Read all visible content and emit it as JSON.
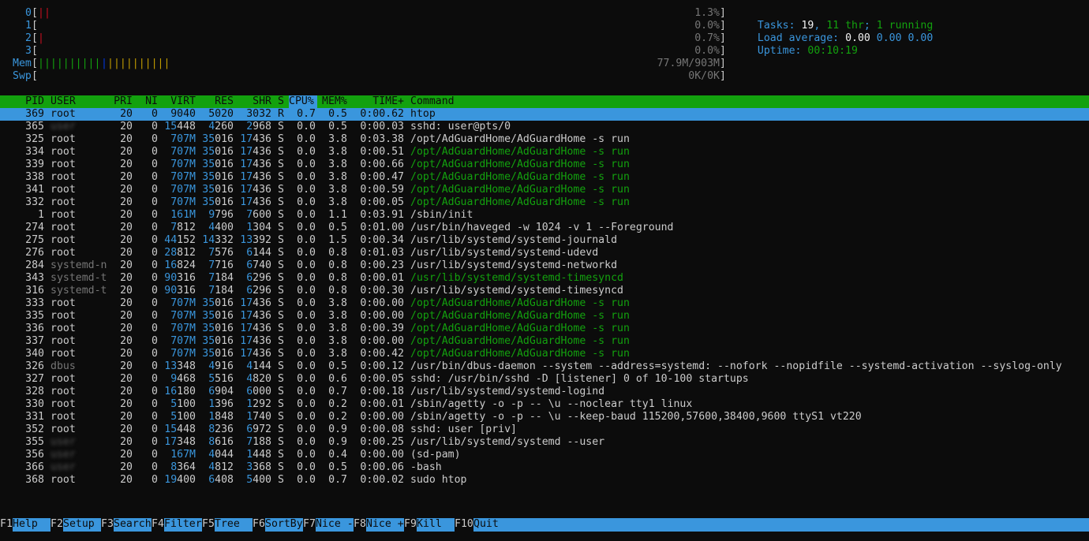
{
  "meters": {
    "cpu": [
      {
        "id": "0",
        "bar": "||",
        "pct": "1.3%"
      },
      {
        "id": "1",
        "bar": "",
        "pct": "0.0%"
      },
      {
        "id": "2",
        "bar": "|",
        "pct": "0.7%"
      },
      {
        "id": "3",
        "bar": "",
        "pct": "0.0%"
      }
    ],
    "mem": {
      "label": "Mem",
      "bar_green": "||||||||||",
      "bar_blue": "|",
      "bar_yellow": "||||||||||",
      "value": "77.9M/903M"
    },
    "swp": {
      "label": "Swp",
      "value": "0K/0K"
    }
  },
  "summary": {
    "tasks_label": "Tasks:",
    "tasks": "19",
    "thr": "11 thr",
    "running": "1 running",
    "load_label": "Load average:",
    "load1": "0.00",
    "load5": "0.00",
    "load15": "0.00",
    "uptime_label": "Uptime:",
    "uptime": "00:10:19"
  },
  "columns": {
    "pid": "PID",
    "user": "USER",
    "pri": "PRI",
    "ni": "NI",
    "virt": "VIRT",
    "res": "RES",
    "shr": "SHR",
    "s": "S",
    "cpu": "CPU%",
    "mem": "MEM%",
    "time": "TIME+",
    "cmd": "Command"
  },
  "processes": [
    {
      "pid": "369",
      "user": "root",
      "pri": "20",
      "ni": "0",
      "virt": "9040",
      "res": "5020",
      "shr": "3032",
      "s": "R",
      "cpu": "0.7",
      "mem": "0.5",
      "time": "0:00.62",
      "cmd": "htop",
      "selected": true
    },
    {
      "pid": "365",
      "user": "user",
      "pri": "20",
      "ni": "0",
      "virt": "15448",
      "res": "4260",
      "shr": "2968",
      "s": "S",
      "cpu": "0.0",
      "mem": "0.5",
      "time": "0:00.03",
      "cmd": "sshd: user@pts/0",
      "blur_user": true
    },
    {
      "pid": "325",
      "user": "root",
      "pri": "20",
      "ni": "0",
      "virt": "707M",
      "res": "35016",
      "shr": "17436",
      "s": "S",
      "cpu": "0.0",
      "mem": "3.8",
      "time": "0:03.38",
      "cmd": "/opt/AdGuardHome/AdGuardHome -s run"
    },
    {
      "pid": "334",
      "user": "root",
      "pri": "20",
      "ni": "0",
      "virt": "707M",
      "res": "35016",
      "shr": "17436",
      "s": "S",
      "cpu": "0.0",
      "mem": "3.8",
      "time": "0:00.51",
      "cmd": "/opt/AdGuardHome/AdGuardHome -s run",
      "thread": true
    },
    {
      "pid": "339",
      "user": "root",
      "pri": "20",
      "ni": "0",
      "virt": "707M",
      "res": "35016",
      "shr": "17436",
      "s": "S",
      "cpu": "0.0",
      "mem": "3.8",
      "time": "0:00.66",
      "cmd": "/opt/AdGuardHome/AdGuardHome -s run",
      "thread": true
    },
    {
      "pid": "338",
      "user": "root",
      "pri": "20",
      "ni": "0",
      "virt": "707M",
      "res": "35016",
      "shr": "17436",
      "s": "S",
      "cpu": "0.0",
      "mem": "3.8",
      "time": "0:00.47",
      "cmd": "/opt/AdGuardHome/AdGuardHome -s run",
      "thread": true
    },
    {
      "pid": "341",
      "user": "root",
      "pri": "20",
      "ni": "0",
      "virt": "707M",
      "res": "35016",
      "shr": "17436",
      "s": "S",
      "cpu": "0.0",
      "mem": "3.8",
      "time": "0:00.59",
      "cmd": "/opt/AdGuardHome/AdGuardHome -s run",
      "thread": true
    },
    {
      "pid": "332",
      "user": "root",
      "pri": "20",
      "ni": "0",
      "virt": "707M",
      "res": "35016",
      "shr": "17436",
      "s": "S",
      "cpu": "0.0",
      "mem": "3.8",
      "time": "0:00.05",
      "cmd": "/opt/AdGuardHome/AdGuardHome -s run",
      "thread": true
    },
    {
      "pid": "1",
      "user": "root",
      "pri": "20",
      "ni": "0",
      "virt": "161M",
      "res": "9796",
      "shr": "7600",
      "s": "S",
      "cpu": "0.0",
      "mem": "1.1",
      "time": "0:03.91",
      "cmd": "/sbin/init"
    },
    {
      "pid": "274",
      "user": "root",
      "pri": "20",
      "ni": "0",
      "virt": "7812",
      "res": "4400",
      "shr": "1304",
      "s": "S",
      "cpu": "0.0",
      "mem": "0.5",
      "time": "0:01.00",
      "cmd": "/usr/bin/haveged -w 1024 -v 1 --Foreground"
    },
    {
      "pid": "275",
      "user": "root",
      "pri": "20",
      "ni": "0",
      "virt": "44152",
      "res": "14332",
      "shr": "13392",
      "s": "S",
      "cpu": "0.0",
      "mem": "1.5",
      "time": "0:00.34",
      "cmd": "/usr/lib/systemd/systemd-journald"
    },
    {
      "pid": "276",
      "user": "root",
      "pri": "20",
      "ni": "0",
      "virt": "28812",
      "res": "7576",
      "shr": "6144",
      "s": "S",
      "cpu": "0.0",
      "mem": "0.8",
      "time": "0:01.03",
      "cmd": "/usr/lib/systemd/systemd-udevd"
    },
    {
      "pid": "284",
      "user": "systemd-n",
      "pri": "20",
      "ni": "0",
      "virt": "16824",
      "res": "7716",
      "shr": "6740",
      "s": "S",
      "cpu": "0.0",
      "mem": "0.8",
      "time": "0:00.23",
      "cmd": "/usr/lib/systemd/systemd-networkd",
      "gray_user": true
    },
    {
      "pid": "343",
      "user": "systemd-t",
      "pri": "20",
      "ni": "0",
      "virt": "90316",
      "res": "7184",
      "shr": "6296",
      "s": "S",
      "cpu": "0.0",
      "mem": "0.8",
      "time": "0:00.01",
      "cmd": "/usr/lib/systemd/systemd-timesyncd",
      "gray_user": true,
      "thread": true
    },
    {
      "pid": "316",
      "user": "systemd-t",
      "pri": "20",
      "ni": "0",
      "virt": "90316",
      "res": "7184",
      "shr": "6296",
      "s": "S",
      "cpu": "0.0",
      "mem": "0.8",
      "time": "0:00.30",
      "cmd": "/usr/lib/systemd/systemd-timesyncd",
      "gray_user": true
    },
    {
      "pid": "333",
      "user": "root",
      "pri": "20",
      "ni": "0",
      "virt": "707M",
      "res": "35016",
      "shr": "17436",
      "s": "S",
      "cpu": "0.0",
      "mem": "3.8",
      "time": "0:00.00",
      "cmd": "/opt/AdGuardHome/AdGuardHome -s run",
      "thread": true
    },
    {
      "pid": "335",
      "user": "root",
      "pri": "20",
      "ni": "0",
      "virt": "707M",
      "res": "35016",
      "shr": "17436",
      "s": "S",
      "cpu": "0.0",
      "mem": "3.8",
      "time": "0:00.00",
      "cmd": "/opt/AdGuardHome/AdGuardHome -s run",
      "thread": true
    },
    {
      "pid": "336",
      "user": "root",
      "pri": "20",
      "ni": "0",
      "virt": "707M",
      "res": "35016",
      "shr": "17436",
      "s": "S",
      "cpu": "0.0",
      "mem": "3.8",
      "time": "0:00.39",
      "cmd": "/opt/AdGuardHome/AdGuardHome -s run",
      "thread": true
    },
    {
      "pid": "337",
      "user": "root",
      "pri": "20",
      "ni": "0",
      "virt": "707M",
      "res": "35016",
      "shr": "17436",
      "s": "S",
      "cpu": "0.0",
      "mem": "3.8",
      "time": "0:00.00",
      "cmd": "/opt/AdGuardHome/AdGuardHome -s run",
      "thread": true
    },
    {
      "pid": "340",
      "user": "root",
      "pri": "20",
      "ni": "0",
      "virt": "707M",
      "res": "35016",
      "shr": "17436",
      "s": "S",
      "cpu": "0.0",
      "mem": "3.8",
      "time": "0:00.42",
      "cmd": "/opt/AdGuardHome/AdGuardHome -s run",
      "thread": true
    },
    {
      "pid": "326",
      "user": "dbus",
      "pri": "20",
      "ni": "0",
      "virt": "13348",
      "res": "4916",
      "shr": "4144",
      "s": "S",
      "cpu": "0.0",
      "mem": "0.5",
      "time": "0:00.12",
      "cmd": "/usr/bin/dbus-daemon --system --address=systemd: --nofork --nopidfile --systemd-activation --syslog-only",
      "gray_user": true
    },
    {
      "pid": "327",
      "user": "root",
      "pri": "20",
      "ni": "0",
      "virt": "9468",
      "res": "5516",
      "shr": "4820",
      "s": "S",
      "cpu": "0.0",
      "mem": "0.6",
      "time": "0:00.05",
      "cmd": "sshd: /usr/bin/sshd -D [listener] 0 of 10-100 startups"
    },
    {
      "pid": "328",
      "user": "root",
      "pri": "20",
      "ni": "0",
      "virt": "16180",
      "res": "6904",
      "shr": "6000",
      "s": "S",
      "cpu": "0.0",
      "mem": "0.7",
      "time": "0:00.18",
      "cmd": "/usr/lib/systemd/systemd-logind"
    },
    {
      "pid": "330",
      "user": "root",
      "pri": "20",
      "ni": "0",
      "virt": "5100",
      "res": "1396",
      "shr": "1292",
      "s": "S",
      "cpu": "0.0",
      "mem": "0.2",
      "time": "0:00.01",
      "cmd": "/sbin/agetty -o -p -- \\u --noclear tty1 linux"
    },
    {
      "pid": "331",
      "user": "root",
      "pri": "20",
      "ni": "0",
      "virt": "5100",
      "res": "1848",
      "shr": "1740",
      "s": "S",
      "cpu": "0.0",
      "mem": "0.2",
      "time": "0:00.00",
      "cmd": "/sbin/agetty -o -p -- \\u --keep-baud 115200,57600,38400,9600 ttyS1 vt220"
    },
    {
      "pid": "352",
      "user": "root",
      "pri": "20",
      "ni": "0",
      "virt": "15448",
      "res": "8236",
      "shr": "6972",
      "s": "S",
      "cpu": "0.0",
      "mem": "0.9",
      "time": "0:00.08",
      "cmd": "sshd: user [priv]"
    },
    {
      "pid": "355",
      "user": "user",
      "pri": "20",
      "ni": "0",
      "virt": "17348",
      "res": "8616",
      "shr": "7188",
      "s": "S",
      "cpu": "0.0",
      "mem": "0.9",
      "time": "0:00.25",
      "cmd": "/usr/lib/systemd/systemd --user",
      "blur_user": true
    },
    {
      "pid": "356",
      "user": "user",
      "pri": "20",
      "ni": "0",
      "virt": "167M",
      "res": "4044",
      "shr": "1448",
      "s": "S",
      "cpu": "0.0",
      "mem": "0.4",
      "time": "0:00.00",
      "cmd": "(sd-pam)",
      "blur_user": true
    },
    {
      "pid": "366",
      "user": "user",
      "pri": "20",
      "ni": "0",
      "virt": "8364",
      "res": "4812",
      "shr": "3368",
      "s": "S",
      "cpu": "0.0",
      "mem": "0.5",
      "time": "0:00.06",
      "cmd": "-bash",
      "blur_user": true
    },
    {
      "pid": "368",
      "user": "root",
      "pri": "20",
      "ni": "0",
      "virt": "19400",
      "res": "6408",
      "shr": "5400",
      "s": "S",
      "cpu": "0.0",
      "mem": "0.7",
      "time": "0:00.02",
      "cmd": "sudo htop"
    }
  ],
  "fkeys": [
    {
      "key": "F1",
      "label": "Help"
    },
    {
      "key": "F2",
      "label": "Setup"
    },
    {
      "key": "F3",
      "label": "Search"
    },
    {
      "key": "F4",
      "label": "Filter"
    },
    {
      "key": "F5",
      "label": "Tree"
    },
    {
      "key": "F6",
      "label": "SortBy"
    },
    {
      "key": "F7",
      "label": "Nice -"
    },
    {
      "key": "F8",
      "label": "Nice +"
    },
    {
      "key": "F9",
      "label": "Kill"
    },
    {
      "key": "F10",
      "label": "Quit"
    }
  ],
  "colors": {
    "header_bar": "#13a10e",
    "selection": "#3a96dd",
    "thread_cmd": "#13a10e",
    "number_highlight": "#3a96dd"
  }
}
